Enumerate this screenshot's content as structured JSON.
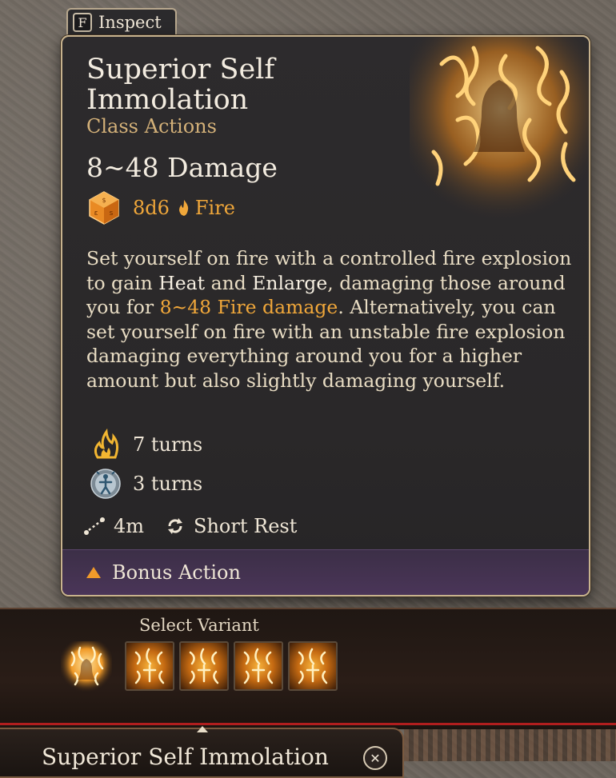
{
  "inspect": {
    "key": "F",
    "label": "Inspect"
  },
  "spell": {
    "title": "Superior Self Immolation",
    "category": "Class Actions",
    "damage": "8~48 Damage",
    "dice": "8d6",
    "damage_type": "Fire",
    "description": {
      "part1": "Set yourself on fire with a controlled fire explosion to gain ",
      "heat": "Heat",
      "and": " and ",
      "enlarge": "Enlarge",
      "part2": ", damaging those around you for ",
      "fire_damage": "8~48 Fire damage",
      "part3": ". Alternatively, you can set yourself on fire with an unstable fire explosion damaging everything around you for a higher amount but also slightly damaging yourself."
    },
    "effects": [
      {
        "icon": "heat-icon",
        "text": "7 turns"
      },
      {
        "icon": "enlarge-icon",
        "text": "3 turns"
      }
    ],
    "range": "4m",
    "recharge": "Short Rest",
    "action_cost": "Bonus Action"
  },
  "variants": {
    "label": "Select Variant",
    "count": 4
  },
  "bottom": {
    "title": "Superior Self Immolation"
  },
  "colors": {
    "accent": "#f0a73a",
    "subtitle": "#d4b179",
    "panel": "#2b292b",
    "bonus_bar": "#4a3558"
  }
}
